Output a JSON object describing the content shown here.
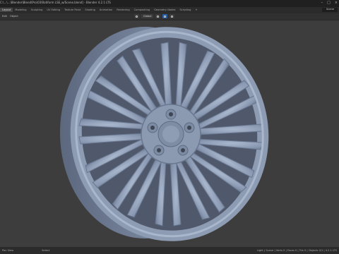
{
  "window": {
    "title": "C:\\...\\...\\Blender\\Blend\\Pro\\03\\Rotiform LSE_w/Scene.blend] - Blender 4.2.1 LTS",
    "controls": [
      "–",
      "□",
      "×"
    ]
  },
  "workspace_tabs": [
    "Layout",
    "Modeling",
    "Sculpting",
    "UV Editing",
    "Texture Paint",
    "Shading",
    "Animation",
    "Rendering",
    "Compositing",
    "Geometry Nodes",
    "Scripting",
    "+"
  ],
  "active_tab": "Layout",
  "scene_selector": {
    "label": "Scene"
  },
  "viewport_header": {
    "menu": [
      "Edit",
      "Object"
    ],
    "transform_orientation": "Global",
    "icons": [
      "orientation-icon",
      "snap-icon",
      "magnet-icon",
      "proportional-icon"
    ]
  },
  "statusbar": {
    "left": [
      "Pan View",
      "Select"
    ],
    "right": "Light | Scene | Verts 0 | Faces 0 | Tris 0 | Objects 0/1 | 4.2.1 LTS"
  },
  "colors": {
    "background": "#3d3d3d",
    "wheel": "#8a99b2",
    "wheel_shadow": "#5e6b82",
    "wheel_highlight": "#b3c1d6"
  }
}
